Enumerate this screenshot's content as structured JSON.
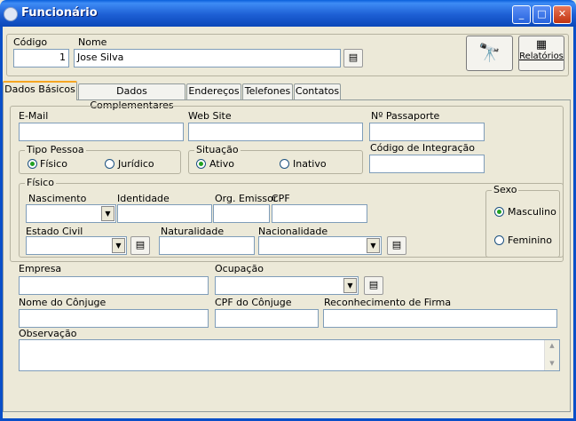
{
  "window": {
    "title": "Funcionário"
  },
  "header": {
    "codigo_label": "Código",
    "codigo_value": "1",
    "nome_label": "Nome",
    "nome_value": "Jose Silva",
    "relatorios_label": "Relatórios"
  },
  "tabs": [
    {
      "label": "Dados Básicos",
      "active": true
    },
    {
      "label": "Dados Complementares"
    },
    {
      "label": "Endereços"
    },
    {
      "label": "Telefones"
    },
    {
      "label": "Contatos"
    }
  ],
  "form": {
    "email_label": "E-Mail",
    "website_label": "Web Site",
    "passaporte_label": "Nº Passaporte",
    "tipo_pessoa": {
      "title": "Tipo Pessoa",
      "options": [
        "Físico",
        "Jurídico"
      ],
      "selected": "Físico"
    },
    "situacao": {
      "title": "Situação",
      "options": [
        "Ativo",
        "Inativo"
      ],
      "selected": "Ativo"
    },
    "codigo_integracao_label": "Código de Integração",
    "fisico": {
      "title": "Físico",
      "nascimento_label": "Nascimento",
      "identidade_label": "Identidade",
      "org_emissor_label": "Org. Emissor",
      "cpf_label": "CPF",
      "estado_civil_label": "Estado Civil",
      "naturalidade_label": "Naturalidade",
      "nacionalidade_label": "Nacionalidade",
      "sexo": {
        "title": "Sexo",
        "options": [
          "Masculino",
          "Feminino"
        ],
        "selected": "Masculino"
      }
    },
    "empresa_label": "Empresa",
    "ocupacao_label": "Ocupação",
    "nome_conjuge_label": "Nome do Cônjuge",
    "cpf_conjuge_label": "CPF do Cônjuge",
    "reconhecimento_label": "Reconhecimento de Firma",
    "observacao_label": "Observação"
  },
  "colors": {
    "titlebar": "#0A5FDB",
    "face": "#ECE9D8",
    "radio_dot": "#21A121",
    "active_tab": "#F5A623"
  }
}
